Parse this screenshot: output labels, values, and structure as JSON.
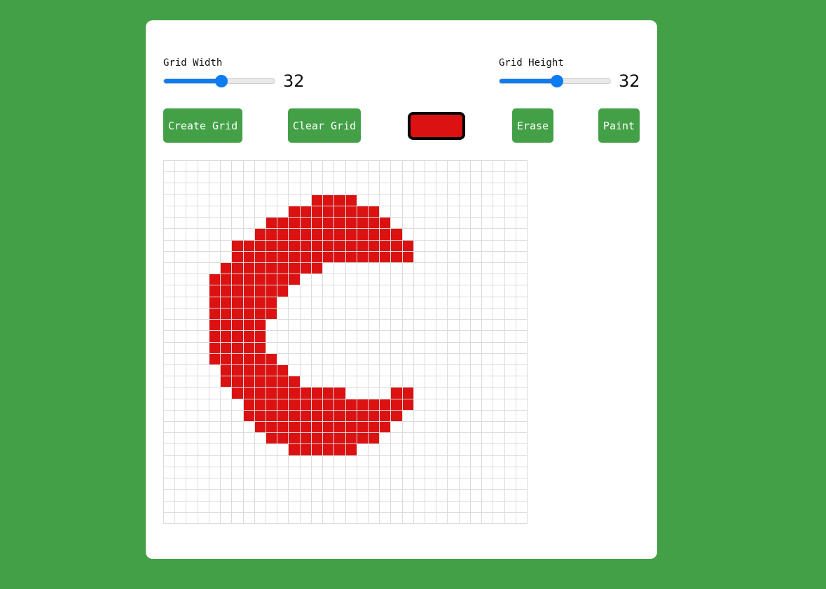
{
  "controls": {
    "width": {
      "label": "Grid Width",
      "value": "32",
      "min": 1,
      "max": 64,
      "fraction": 0.52
    },
    "height": {
      "label": "Grid Height",
      "value": "32",
      "min": 1,
      "max": 64,
      "fraction": 0.52
    }
  },
  "buttons": {
    "create": "Create Grid",
    "clear": "Clear Grid",
    "erase": "Erase",
    "paint": "Paint"
  },
  "colors": {
    "paint_color": "#dc1111",
    "accent": "#43a047",
    "slider": "#0d7bf2",
    "cell_border": "#dcdcdc"
  },
  "grid": {
    "cols": 32,
    "rows": 32,
    "filled_rows": [
      {
        "row": 3,
        "spans": [
          [
            13,
            16
          ]
        ]
      },
      {
        "row": 4,
        "spans": [
          [
            11,
            18
          ]
        ]
      },
      {
        "row": 5,
        "spans": [
          [
            9,
            19
          ]
        ]
      },
      {
        "row": 6,
        "spans": [
          [
            8,
            20
          ]
        ]
      },
      {
        "row": 7,
        "spans": [
          [
            6,
            21
          ]
        ]
      },
      {
        "row": 8,
        "spans": [
          [
            6,
            21
          ]
        ]
      },
      {
        "row": 9,
        "spans": [
          [
            5,
            13
          ]
        ]
      },
      {
        "row": 10,
        "spans": [
          [
            4,
            11
          ]
        ]
      },
      {
        "row": 11,
        "spans": [
          [
            4,
            10
          ]
        ]
      },
      {
        "row": 12,
        "spans": [
          [
            4,
            9
          ]
        ]
      },
      {
        "row": 13,
        "spans": [
          [
            4,
            9
          ]
        ]
      },
      {
        "row": 14,
        "spans": [
          [
            4,
            8
          ]
        ]
      },
      {
        "row": 15,
        "spans": [
          [
            4,
            8
          ]
        ]
      },
      {
        "row": 16,
        "spans": [
          [
            4,
            8
          ]
        ]
      },
      {
        "row": 17,
        "spans": [
          [
            4,
            9
          ]
        ]
      },
      {
        "row": 18,
        "spans": [
          [
            5,
            10
          ]
        ]
      },
      {
        "row": 19,
        "spans": [
          [
            5,
            11
          ]
        ]
      },
      {
        "row": 20,
        "spans": [
          [
            6,
            15
          ],
          [
            20,
            21
          ]
        ]
      },
      {
        "row": 21,
        "spans": [
          [
            7,
            21
          ]
        ]
      },
      {
        "row": 22,
        "spans": [
          [
            7,
            20
          ]
        ]
      },
      {
        "row": 23,
        "spans": [
          [
            8,
            19
          ]
        ]
      },
      {
        "row": 24,
        "spans": [
          [
            9,
            18
          ]
        ]
      },
      {
        "row": 25,
        "spans": [
          [
            11,
            16
          ]
        ]
      }
    ]
  }
}
